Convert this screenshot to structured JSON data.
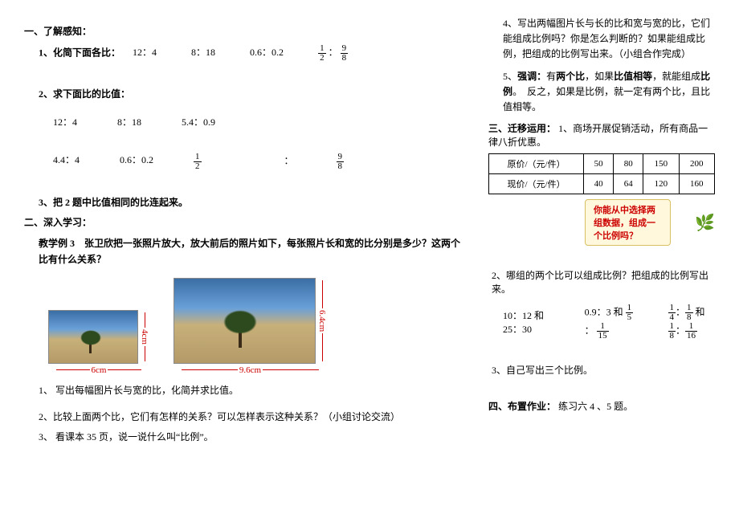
{
  "left": {
    "s1_title": "一、了解感知：",
    "q1_label": "1、化简下面各比：",
    "q1_ratios": {
      "a": "12：4",
      "b": "8：18",
      "c": "0.6：0.2"
    },
    "q1_frac": {
      "n1": "1",
      "d1": "2",
      "sep": "：",
      "n2": "9",
      "d2": "8"
    },
    "q2_label": "2、求下面比的比值：",
    "q2_row1": {
      "a": "12：4",
      "b": "8：18",
      "c": "5.4：0.9"
    },
    "q2_row2": {
      "a": "4.4：4",
      "b": "0.6：0.2"
    },
    "q2_frac": {
      "n1": "1",
      "d1": "2",
      "sep": "：",
      "n2": "9",
      "d2": "8"
    },
    "q3_label": "3、把 2 题中比值相同的比连起来。",
    "s2_title": "二、深入学习：",
    "ex_prefix": "教学例 3　",
    "ex_text": "张卫欣把一张照片放大，放大前后的照片如下，每张照片长和宽的比分别是多少？这两个比有什么关系？",
    "photo_small_w": "6cm",
    "photo_small_h": "4cm",
    "photo_large_w": "9.6cm",
    "photo_large_h": "6.4cm",
    "p1": "1、 写出每幅图片长与宽的比，化简并求比值。",
    "p2": "2、比较上面两个比，它们有怎样的关系？可以怎样表示这种关系？（小组讨论交流）",
    "p3": "3、 看课本 35 页，说一说什么叫“比例”。"
  },
  "right": {
    "r4": "4、写出两幅图片长与长的比和宽与宽的比，它们能组成比例吗？你是怎么判断的？如果能组成比例，把组成的比例写出来。（小组合作完成）",
    "r5_prefix": "5、",
    "r5_k1": "强调：",
    "r5_a": "有",
    "r5_k2": "两个比",
    "r5_b": "，如果",
    "r5_k3": "比值相等",
    "r5_c": "，就能组成",
    "r5_k4": "比例",
    "r5_d": "。　反之，如果是比例，就一定有两个比，且比值相等。",
    "s3_title": "三、迁移运用：",
    "s3_body": "1、商场开展促销活动，所有商品一律八折优惠。",
    "table": {
      "h1": "原价/（元/件）",
      "h2": "现价/（元/件）",
      "r1": [
        "50",
        "80",
        "150",
        "200"
      ],
      "r2": [
        "40",
        "64",
        "120",
        "160"
      ]
    },
    "callout": "你能从中选择两组数据，组成一个比例吗？",
    "t2": "2、哪组的两个比可以组成比例？把组成的比例写出来。",
    "t2_a": "10：12 和 25：30",
    "t2_b_lead": "0.9：3 和 ",
    "t2_b_f1": {
      "n": "1",
      "d": "5"
    },
    "t2_b_sep": " ： ",
    "t2_b_f2": {
      "n": "1",
      "d": "15"
    },
    "t2_c_f1": {
      "n": "1",
      "d": "4"
    },
    "t2_c_s1": "：",
    "t2_c_f2": {
      "n": "1",
      "d": "8"
    },
    "t2_c_mid": " 和 ",
    "t2_c_f3": {
      "n": "1",
      "d": "8"
    },
    "t2_c_s2": "：",
    "t2_c_f4": {
      "n": "1",
      "d": "16"
    },
    "t3": "3、自己写出三个比例。",
    "s4_title": "四、布置作业：",
    "s4_body": "练习六 4 、5 题。"
  }
}
